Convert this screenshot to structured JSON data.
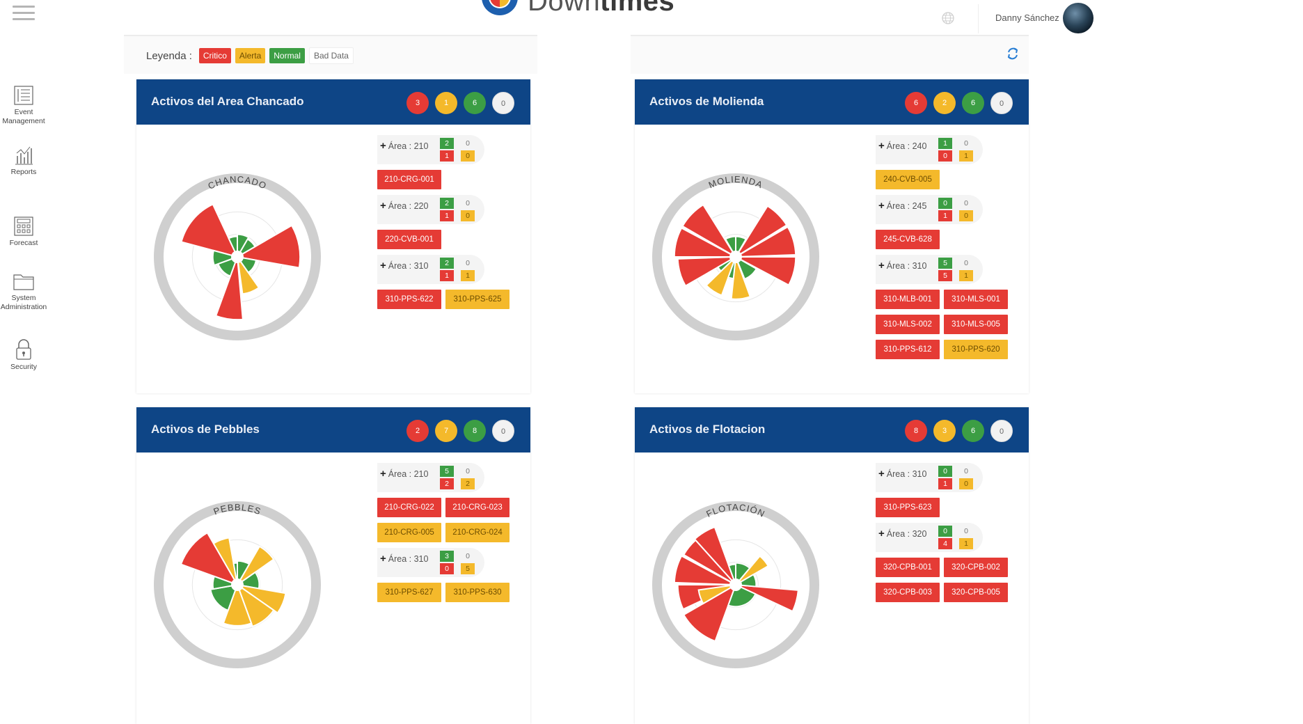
{
  "app": {
    "logo_prefix": "Down",
    "logo_suffix": "times",
    "user": "Danny Sánchez"
  },
  "sidebar": {
    "items": [
      {
        "label": "Event Management",
        "icon": "list-icon"
      },
      {
        "label": "Reports",
        "icon": "bar-chart-icon"
      },
      {
        "label": "Forecast",
        "icon": "calculator-icon"
      },
      {
        "label": "System Administration",
        "icon": "folder-icon"
      },
      {
        "label": "Security",
        "icon": "lock-icon"
      }
    ]
  },
  "legend": {
    "label": "Leyenda :",
    "items": [
      {
        "label": "Critico",
        "color": "#e53b35"
      },
      {
        "label": "Alerta",
        "color": "#f4b92b"
      },
      {
        "label": "Normal",
        "color": "#3c9e44"
      },
      {
        "label": "Bad Data",
        "color": "#ffffff"
      }
    ]
  },
  "colors": {
    "critical": "#e53b35",
    "alert": "#f4b92b",
    "normal": "#3c9e44",
    "header": "#0e4586"
  },
  "cards": [
    {
      "title": "Activos del Area Chancado",
      "counts": [
        "3",
        "1",
        "6",
        "0"
      ],
      "radar_label": "CHANCADO",
      "areas": [
        {
          "label": "Área : 210",
          "normal": "2",
          "bad": "0",
          "critical": "1",
          "alert": "0",
          "assets": [
            {
              "label": "210-CRG-001",
              "status": "red"
            }
          ]
        },
        {
          "label": "Área : 220",
          "normal": "2",
          "bad": "0",
          "critical": "1",
          "alert": "0",
          "assets": [
            {
              "label": "220-CVB-001",
              "status": "red"
            }
          ]
        },
        {
          "label": "Área : 310",
          "normal": "2",
          "bad": "0",
          "critical": "1",
          "alert": "1",
          "assets": [
            {
              "label": "310-PPS-622",
              "status": "red"
            },
            {
              "label": "310-PPS-625",
              "status": "yellow"
            }
          ]
        }
      ]
    },
    {
      "title": "Activos de Molienda",
      "counts": [
        "6",
        "2",
        "6",
        "0"
      ],
      "radar_label": "MOLIENDA",
      "areas": [
        {
          "label": "Área : 240",
          "normal": "1",
          "bad": "0",
          "critical": "0",
          "alert": "1",
          "assets": [
            {
              "label": "240-CVB-005",
              "status": "yellow"
            }
          ]
        },
        {
          "label": "Área : 245",
          "normal": "0",
          "bad": "0",
          "critical": "1",
          "alert": "0",
          "assets": [
            {
              "label": "245-CVB-628",
              "status": "red"
            }
          ]
        },
        {
          "label": "Área : 310",
          "normal": "5",
          "bad": "0",
          "critical": "5",
          "alert": "1",
          "assets": [
            {
              "label": "310-MLB-001",
              "status": "red"
            },
            {
              "label": "310-MLS-001",
              "status": "red"
            },
            {
              "label": "310-MLS-002",
              "status": "red"
            },
            {
              "label": "310-MLS-005",
              "status": "red"
            },
            {
              "label": "310-PPS-612",
              "status": "red"
            },
            {
              "label": "310-PPS-620",
              "status": "yellow"
            }
          ]
        }
      ]
    },
    {
      "title": "Activos de Pebbles",
      "counts": [
        "2",
        "7",
        "8",
        "0"
      ],
      "radar_label": "PEBBLES",
      "areas": [
        {
          "label": "Área : 210",
          "normal": "5",
          "bad": "0",
          "critical": "2",
          "alert": "2",
          "assets": [
            {
              "label": "210-CRG-022",
              "status": "red"
            },
            {
              "label": "210-CRG-023",
              "status": "red"
            },
            {
              "label": "210-CRG-005",
              "status": "yellow"
            },
            {
              "label": "210-CRG-024",
              "status": "yellow"
            }
          ]
        },
        {
          "label": "Área : 310",
          "normal": "3",
          "bad": "0",
          "critical": "0",
          "alert": "5",
          "assets": [
            {
              "label": "310-PPS-627",
              "status": "yellow"
            },
            {
              "label": "310-PPS-630",
              "status": "yellow"
            }
          ]
        }
      ]
    },
    {
      "title": "Activos de Flotacion",
      "counts": [
        "8",
        "3",
        "6",
        "0"
      ],
      "radar_label": "FLOTACIÓN",
      "areas": [
        {
          "label": "Área : 310",
          "normal": "0",
          "bad": "0",
          "critical": "1",
          "alert": "0",
          "assets": [
            {
              "label": "310-PPS-623",
              "status": "red"
            }
          ]
        },
        {
          "label": "Área : 320",
          "normal": "0",
          "bad": "0",
          "critical": "4",
          "alert": "1",
          "assets": [
            {
              "label": "320-CPB-001",
              "status": "red"
            },
            {
              "label": "320-CPB-002",
              "status": "red"
            },
            {
              "label": "320-CPB-003",
              "status": "red"
            },
            {
              "label": "320-CPB-005",
              "status": "red"
            }
          ]
        }
      ]
    }
  ],
  "radar_sectors": [
    [
      {
        "start": 285,
        "end": 335,
        "r": 0.85,
        "status": "critical"
      },
      {
        "start": 60,
        "end": 100,
        "r": 0.92,
        "status": "critical"
      },
      {
        "start": 175,
        "end": 200,
        "r": 0.92,
        "status": "critical"
      },
      {
        "start": 145,
        "end": 172,
        "r": 0.55,
        "status": "alert"
      },
      {
        "start": 0,
        "end": 30,
        "r": 0.33,
        "status": "normal"
      },
      {
        "start": 30,
        "end": 60,
        "r": 0.3,
        "status": "normal"
      },
      {
        "start": 100,
        "end": 145,
        "r": 0.28,
        "status": "normal"
      },
      {
        "start": 200,
        "end": 250,
        "r": 0.3,
        "status": "normal"
      },
      {
        "start": 250,
        "end": 285,
        "r": 0.36,
        "status": "normal"
      },
      {
        "start": 335,
        "end": 360,
        "r": 0.3,
        "status": "normal"
      }
    ],
    [
      {
        "start": 300,
        "end": 328,
        "r": 0.9,
        "status": "critical"
      },
      {
        "start": 270,
        "end": 298,
        "r": 0.9,
        "status": "critical"
      },
      {
        "start": 240,
        "end": 268,
        "r": 0.85,
        "status": "critical"
      },
      {
        "start": 32,
        "end": 58,
        "r": 0.88,
        "status": "critical"
      },
      {
        "start": 60,
        "end": 88,
        "r": 0.88,
        "status": "critical"
      },
      {
        "start": 90,
        "end": 118,
        "r": 0.88,
        "status": "critical"
      },
      {
        "start": 200,
        "end": 226,
        "r": 0.6,
        "status": "alert"
      },
      {
        "start": 160,
        "end": 186,
        "r": 0.62,
        "status": "alert"
      },
      {
        "start": 330,
        "end": 360,
        "r": 0.3,
        "status": "normal"
      },
      {
        "start": 0,
        "end": 30,
        "r": 0.3,
        "status": "normal"
      },
      {
        "start": 120,
        "end": 158,
        "r": 0.35,
        "status": "normal"
      },
      {
        "start": 186,
        "end": 200,
        "r": 0.32,
        "status": "normal"
      },
      {
        "start": 226,
        "end": 240,
        "r": 0.3,
        "status": "normal"
      }
    ],
    [
      {
        "start": 290,
        "end": 330,
        "r": 0.88,
        "status": "critical"
      },
      {
        "start": 330,
        "end": 350,
        "r": 0.7,
        "status": "alert"
      },
      {
        "start": 30,
        "end": 55,
        "r": 0.65,
        "status": "alert"
      },
      {
        "start": 55,
        "end": 100,
        "r": 0.32,
        "status": "normal"
      },
      {
        "start": 100,
        "end": 125,
        "r": 0.72,
        "status": "alert"
      },
      {
        "start": 125,
        "end": 160,
        "r": 0.65,
        "status": "alert"
      },
      {
        "start": 160,
        "end": 200,
        "r": 0.6,
        "status": "alert"
      },
      {
        "start": 200,
        "end": 260,
        "r": 0.4,
        "status": "normal"
      },
      {
        "start": 260,
        "end": 290,
        "r": 0.36,
        "status": "normal"
      },
      {
        "start": 350,
        "end": 360,
        "r": 0.32,
        "status": "normal"
      },
      {
        "start": 0,
        "end": 30,
        "r": 0.35,
        "status": "normal"
      }
    ],
    [
      {
        "start": 318,
        "end": 340,
        "r": 0.9,
        "status": "critical"
      },
      {
        "start": 300,
        "end": 318,
        "r": 0.88,
        "status": "critical"
      },
      {
        "start": 272,
        "end": 298,
        "r": 0.9,
        "status": "critical"
      },
      {
        "start": 245,
        "end": 270,
        "r": 0.85,
        "status": "critical"
      },
      {
        "start": 200,
        "end": 240,
        "r": 0.88,
        "status": "critical"
      },
      {
        "start": 95,
        "end": 115,
        "r": 0.92,
        "status": "critical"
      },
      {
        "start": 40,
        "end": 60,
        "r": 0.55,
        "status": "alert"
      },
      {
        "start": 240,
        "end": 262,
        "r": 0.55,
        "status": "alert"
      },
      {
        "start": 340,
        "end": 360,
        "r": 0.3,
        "status": "normal"
      },
      {
        "start": 0,
        "end": 40,
        "r": 0.32,
        "status": "normal"
      },
      {
        "start": 60,
        "end": 95,
        "r": 0.3,
        "status": "normal"
      },
      {
        "start": 115,
        "end": 200,
        "r": 0.32,
        "status": "normal"
      }
    ]
  ]
}
